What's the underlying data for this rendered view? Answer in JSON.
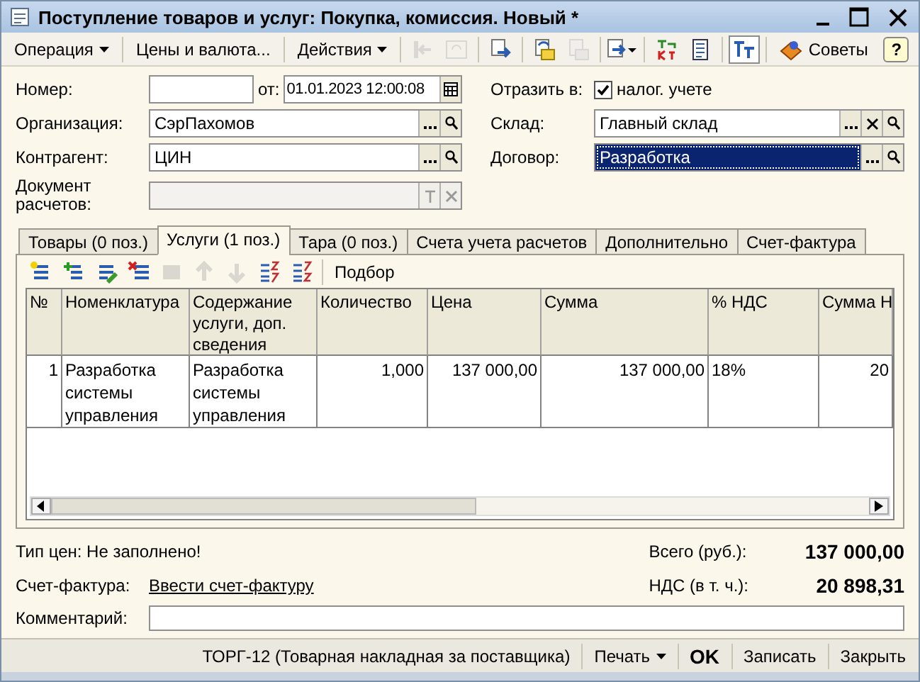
{
  "window": {
    "title": "Поступление товаров и услуг: Покупка, комиссия. Новый *"
  },
  "toolbar": [
    {
      "kind": "menu",
      "label": "Операция"
    },
    {
      "kind": "text",
      "label": "Цены и валюта..."
    },
    {
      "kind": "menu",
      "label": "Действия"
    },
    {
      "kind": "icon",
      "disabled": true
    },
    {
      "kind": "icon",
      "disabled": true
    },
    {
      "kind": "icon",
      "disabled": false
    },
    {
      "kind": "icon",
      "disabled": false
    },
    {
      "kind": "icon",
      "disabled": true
    },
    {
      "kind": "icon",
      "disabled": false
    },
    {
      "kind": "icon",
      "disabled": false
    },
    {
      "kind": "icon",
      "disabled": false
    },
    {
      "kind": "icon",
      "disabled": false
    },
    {
      "kind": "text",
      "label": "Советы"
    },
    {
      "kind": "help",
      "label": "?"
    }
  ],
  "header": {
    "number": {
      "label": "Номер:",
      "date_label": "от:",
      "date": "01.01.2023 12:00:08"
    },
    "organization": {
      "label": "Организация:",
      "value": "СэрПахомов"
    },
    "counterparty": {
      "label": "Контрагент:",
      "value": "ЦИН"
    },
    "settlement_document": {
      "label": "Документ расчетов:",
      "disabled": true
    },
    "reflect": {
      "label": "Отразить в:",
      "option": "налог. учете",
      "checked": true
    },
    "warehouse": {
      "label": "Склад:",
      "value": "Главный склад",
      "selected": false
    },
    "contract": {
      "label": "Договор:",
      "value": "Разработка",
      "selected": true
    }
  },
  "tabs": [
    {
      "label": "Товары (0 поз.)",
      "selected": false
    },
    {
      "label": "Услуги (1 поз.)",
      "selected": true
    },
    {
      "label": "Тара (0 поз.)",
      "selected": false
    },
    {
      "label": "Счета учета расчетов",
      "selected": false
    },
    {
      "label": "Дополнительно",
      "selected": false
    },
    {
      "label": "Счет-фактура",
      "selected": false
    }
  ],
  "table_toolbar": [
    {
      "kind": "icon",
      "disabled": false
    },
    {
      "kind": "icon",
      "disabled": false
    },
    {
      "kind": "icon",
      "disabled": false
    },
    {
      "kind": "icon",
      "disabled": false
    },
    {
      "kind": "icon",
      "disabled": true
    },
    {
      "kind": "icon",
      "disabled": true
    },
    {
      "kind": "icon",
      "disabled": true
    },
    {
      "kind": "icon",
      "disabled": false
    },
    {
      "kind": "icon",
      "disabled": false
    },
    {
      "kind": "text",
      "label": "Подбор"
    }
  ],
  "table": {
    "columns": [
      "№",
      "Номенклатура",
      "Содержание услуги, доп. сведения",
      "Количество",
      "Цена",
      "Сумма",
      "% НДС",
      "Сумма Н"
    ],
    "rows": [
      [
        "1",
        "Разработка системы управления",
        "Разработка системы управления",
        "1,000",
        "137 000,00",
        "137 000,00",
        "18%",
        "20"
      ]
    ]
  },
  "footer": {
    "price_type": "Тип цен: Не заполнено!",
    "invoice_label": "Счет-фактура:",
    "invoice_link": "Ввести счет-фактуру",
    "total_label": "Всего (руб.):",
    "total": "137 000,00",
    "vat_label": "НДС (в т. ч.):",
    "vat": "20 898,31",
    "comment_label": "Комментарий:"
  },
  "bottom_bar": [
    {
      "kind": "text",
      "label": "ТОРГ-12 (Товарная накладная за поставщика)"
    },
    {
      "kind": "menu",
      "label": "Печать"
    },
    {
      "kind": "default",
      "label": "OK"
    },
    {
      "kind": "text",
      "label": "Записать"
    },
    {
      "kind": "text",
      "label": "Закрыть"
    }
  ]
}
